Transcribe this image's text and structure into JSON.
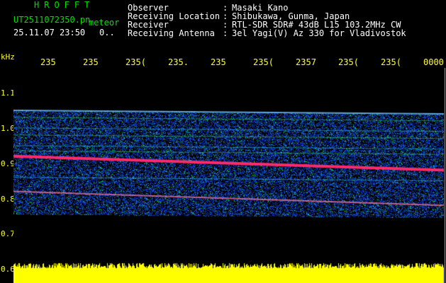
{
  "header": {
    "brand": "HROFFT",
    "filename": "UT2511072350.pn",
    "mode": "meteor",
    "datetime": "25.11.07 23:50",
    "counter": "0..",
    "info": [
      {
        "label": "Observer",
        "sep": ":",
        "value": "Masaki Kano"
      },
      {
        "label": "Receiving Location",
        "sep": ":",
        "value": "Shibukawa, Gunma, Japan"
      },
      {
        "label": "Receiver",
        "sep": ":",
        "value": "RTL-SDR SDR# 43dB L15 103.2MHz CW"
      },
      {
        "label": "Receiving Antenna",
        "sep": ":",
        "value": "3el Yagi(V) Az 330 for Vladivostok"
      }
    ]
  },
  "axis": {
    "y_unit": "kHz",
    "y_ticks": [
      "1.1",
      "1.0",
      "0.9",
      "0.8",
      "0.7",
      "0.6"
    ],
    "x_ticks": [
      "235",
      "235",
      "235",
      "235",
      "235",
      "235",
      "235",
      "235",
      "235",
      "0000"
    ],
    "x_tick_suffixes": [
      "",
      "",
      "(",
      ".",
      "",
      "(",
      "7",
      "(",
      "(",
      ""
    ]
  },
  "spectrogram": {
    "background": "#000000",
    "noise_color": "#0a30c8",
    "trace_color": "#ff2a6a",
    "signal_color": "#2cff40",
    "bar_color": "#ffff00",
    "traces": [
      {
        "name": "carrier-upper",
        "start_khz": 1.05,
        "end_khz": 1.04
      },
      {
        "name": "carrier-main",
        "start_khz": 0.92,
        "end_khz": 0.88
      },
      {
        "name": "carrier-lower",
        "start_khz": 0.82,
        "end_khz": 0.78
      }
    ]
  }
}
